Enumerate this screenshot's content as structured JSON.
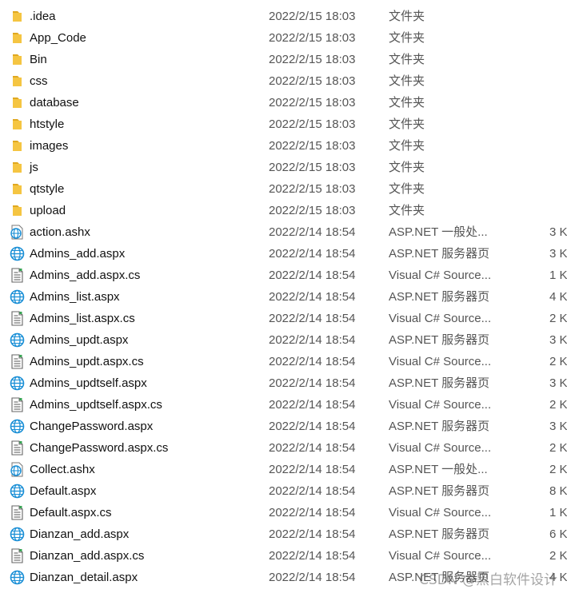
{
  "colors": {
    "folder": "#f5c542",
    "folder_dark": "#e0a820",
    "web_icon": "#1a8fd6",
    "text_primary": "#111111",
    "text_secondary": "#555555"
  },
  "files": [
    {
      "name": ".idea",
      "date": "2022/2/15 18:03",
      "type": "文件夹",
      "size": "",
      "icon": "folder-icon"
    },
    {
      "name": "App_Code",
      "date": "2022/2/15 18:03",
      "type": "文件夹",
      "size": "",
      "icon": "folder-icon"
    },
    {
      "name": "Bin",
      "date": "2022/2/15 18:03",
      "type": "文件夹",
      "size": "",
      "icon": "folder-icon"
    },
    {
      "name": "css",
      "date": "2022/2/15 18:03",
      "type": "文件夹",
      "size": "",
      "icon": "folder-icon"
    },
    {
      "name": "database",
      "date": "2022/2/15 18:03",
      "type": "文件夹",
      "size": "",
      "icon": "folder-icon"
    },
    {
      "name": "htstyle",
      "date": "2022/2/15 18:03",
      "type": "文件夹",
      "size": "",
      "icon": "folder-icon"
    },
    {
      "name": "images",
      "date": "2022/2/15 18:03",
      "type": "文件夹",
      "size": "",
      "icon": "folder-icon"
    },
    {
      "name": "js",
      "date": "2022/2/15 18:03",
      "type": "文件夹",
      "size": "",
      "icon": "folder-icon"
    },
    {
      "name": "qtstyle",
      "date": "2022/2/15 18:03",
      "type": "文件夹",
      "size": "",
      "icon": "folder-icon"
    },
    {
      "name": "upload",
      "date": "2022/2/15 18:03",
      "type": "文件夹",
      "size": "",
      "icon": "folder-icon"
    },
    {
      "name": "action.ashx",
      "date": "2022/2/14 18:54",
      "type": "ASP.NET 一般处...",
      "size": "3 K",
      "icon": "ashx-file-icon"
    },
    {
      "name": "Admins_add.aspx",
      "date": "2022/2/14 18:54",
      "type": "ASP.NET 服务器页",
      "size": "3 K",
      "icon": "aspx-file-icon"
    },
    {
      "name": "Admins_add.aspx.cs",
      "date": "2022/2/14 18:54",
      "type": "Visual C# Source...",
      "size": "1 K",
      "icon": "cs-file-icon"
    },
    {
      "name": "Admins_list.aspx",
      "date": "2022/2/14 18:54",
      "type": "ASP.NET 服务器页",
      "size": "4 K",
      "icon": "aspx-file-icon"
    },
    {
      "name": "Admins_list.aspx.cs",
      "date": "2022/2/14 18:54",
      "type": "Visual C# Source...",
      "size": "2 K",
      "icon": "cs-file-icon"
    },
    {
      "name": "Admins_updt.aspx",
      "date": "2022/2/14 18:54",
      "type": "ASP.NET 服务器页",
      "size": "3 K",
      "icon": "aspx-file-icon"
    },
    {
      "name": "Admins_updt.aspx.cs",
      "date": "2022/2/14 18:54",
      "type": "Visual C# Source...",
      "size": "2 K",
      "icon": "cs-file-icon"
    },
    {
      "name": "Admins_updtself.aspx",
      "date": "2022/2/14 18:54",
      "type": "ASP.NET 服务器页",
      "size": "3 K",
      "icon": "aspx-file-icon"
    },
    {
      "name": "Admins_updtself.aspx.cs",
      "date": "2022/2/14 18:54",
      "type": "Visual C# Source...",
      "size": "2 K",
      "icon": "cs-file-icon"
    },
    {
      "name": "ChangePassword.aspx",
      "date": "2022/2/14 18:54",
      "type": "ASP.NET 服务器页",
      "size": "3 K",
      "icon": "aspx-file-icon"
    },
    {
      "name": "ChangePassword.aspx.cs",
      "date": "2022/2/14 18:54",
      "type": "Visual C# Source...",
      "size": "2 K",
      "icon": "cs-file-icon"
    },
    {
      "name": "Collect.ashx",
      "date": "2022/2/14 18:54",
      "type": "ASP.NET 一般处...",
      "size": "2 K",
      "icon": "ashx-file-icon"
    },
    {
      "name": "Default.aspx",
      "date": "2022/2/14 18:54",
      "type": "ASP.NET 服务器页",
      "size": "8 K",
      "icon": "aspx-file-icon"
    },
    {
      "name": "Default.aspx.cs",
      "date": "2022/2/14 18:54",
      "type": "Visual C# Source...",
      "size": "1 K",
      "icon": "cs-file-icon"
    },
    {
      "name": "Dianzan_add.aspx",
      "date": "2022/2/14 18:54",
      "type": "ASP.NET 服务器页",
      "size": "6 K",
      "icon": "aspx-file-icon"
    },
    {
      "name": "Dianzan_add.aspx.cs",
      "date": "2022/2/14 18:54",
      "type": "Visual C# Source...",
      "size": "2 K",
      "icon": "cs-file-icon"
    },
    {
      "name": "Dianzan_detail.aspx",
      "date": "2022/2/14 18:54",
      "type": "ASP.NET 服务器页",
      "size": "4 K",
      "icon": "aspx-file-icon"
    }
  ],
  "watermark": "CSDN @黑白软件设计"
}
